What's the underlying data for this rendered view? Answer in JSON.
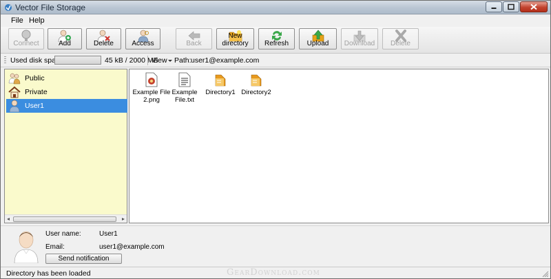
{
  "window": {
    "title": "Vector File Storage"
  },
  "menu": {
    "items": [
      "File",
      "Help"
    ]
  },
  "toolbar": {
    "buttons": [
      {
        "label": "Connect",
        "icon": "connect-icon",
        "enabled": false
      },
      {
        "label": "Add",
        "icon": "add-user-icon",
        "enabled": true
      },
      {
        "label": "Delete",
        "icon": "delete-user-icon",
        "enabled": true
      },
      {
        "label": "Access",
        "icon": "access-icon",
        "enabled": true
      },
      {
        "label": "Back",
        "icon": "back-arrow-icon",
        "enabled": false
      },
      {
        "label": "New directory",
        "icon": "new-folder-icon",
        "enabled": true
      },
      {
        "label": "Refresh",
        "icon": "refresh-icon",
        "enabled": true
      },
      {
        "label": "Upload",
        "icon": "upload-icon",
        "enabled": true
      },
      {
        "label": "Download",
        "icon": "download-icon",
        "enabled": false
      },
      {
        "label": "Delete",
        "icon": "delete-x-icon",
        "enabled": false
      }
    ]
  },
  "infobar": {
    "disk_label": "Used disk space",
    "disk_usage_text": "45 kB / 2000 MB",
    "disk_usage_fraction": 0.0,
    "view_label": "View",
    "path_label": "Path:",
    "path_value": "user1@example.com"
  },
  "tree": {
    "items": [
      {
        "label": "Public",
        "icon": "public-users-icon",
        "selected": false
      },
      {
        "label": "Private",
        "icon": "house-icon",
        "selected": false
      },
      {
        "label": "User1",
        "icon": "user-icon",
        "selected": true
      }
    ]
  },
  "files": {
    "items": [
      {
        "name": "Example File 2.png",
        "icon": "png-file-icon"
      },
      {
        "name": "Example File.txt",
        "icon": "txt-file-icon"
      },
      {
        "name": "Directory1",
        "icon": "folder-icon"
      },
      {
        "name": "Directory2",
        "icon": "folder-icon"
      }
    ]
  },
  "user_panel": {
    "username_label": "User name:",
    "username_value": "User1",
    "email_label": "Email:",
    "email_value": "user1@example.com",
    "notify_button": "Send notification"
  },
  "status": {
    "text": "Directory has been loaded",
    "watermark": "GearDownload.com"
  },
  "colors": {
    "selection": "#3b8de0",
    "tree_background": "#fafacc",
    "disk_fill": "#2fb34a"
  }
}
